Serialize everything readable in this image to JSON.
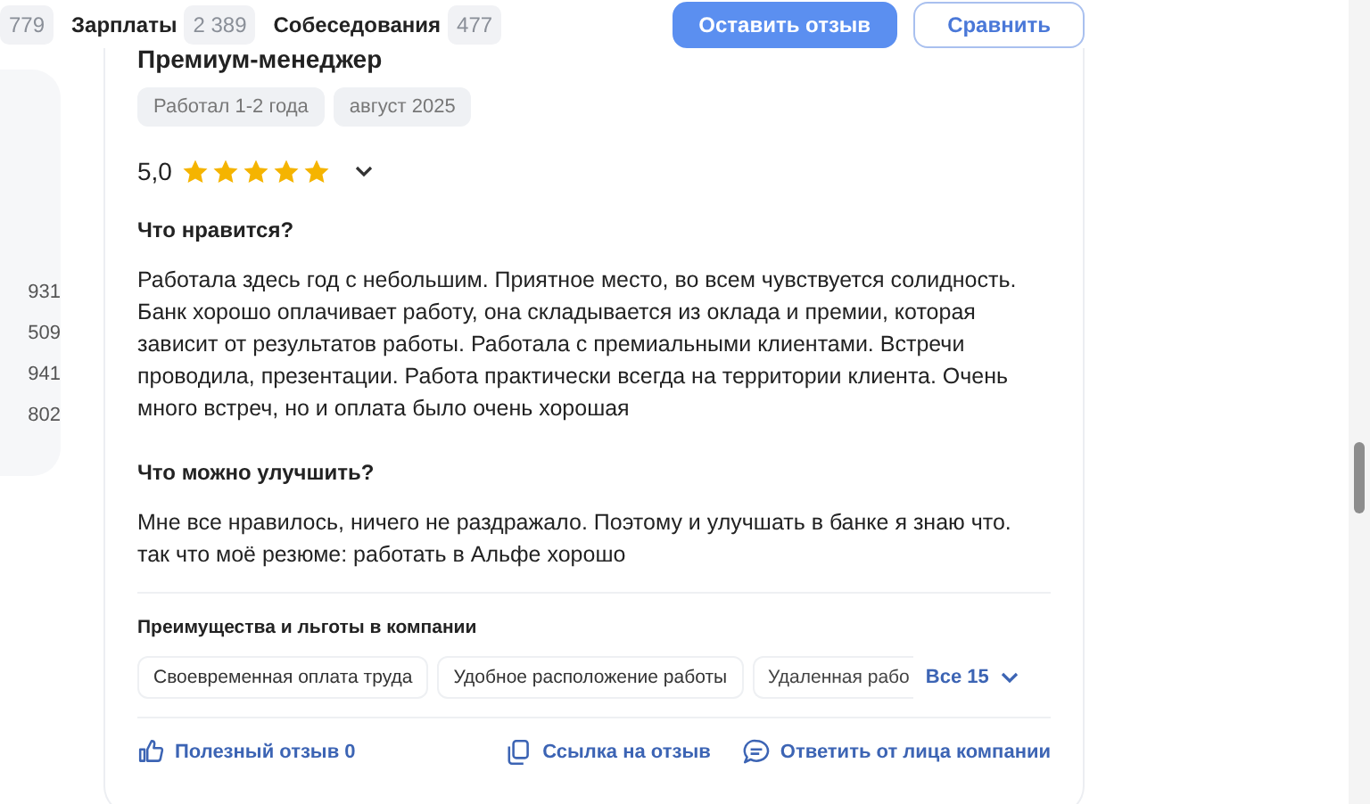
{
  "header": {
    "tabs": [
      {
        "count": "779"
      },
      {
        "label": "Зарплаты",
        "count": "2 389"
      },
      {
        "label": "Собеседования",
        "count": "477"
      }
    ],
    "buttons": [
      {
        "label": "Оставить отзыв",
        "kind": "primary"
      },
      {
        "label": "Сравнить",
        "kind": "outline"
      }
    ]
  },
  "sidebar": {
    "counts": [
      "931",
      "509",
      "941",
      "802"
    ]
  },
  "review": {
    "position": "Премиум-менеджер",
    "tags": [
      "Работал 1-2 года",
      "август 2025"
    ],
    "rating": "5,0",
    "stars": 5,
    "sections": [
      {
        "title": "Что нравится?",
        "text": "Работала здесь год с небольшим. Приятное место, во всем чувствуется солидность. Банк хорошо оплачивает работу, она складывается из оклада и премии, которая зависит от результатов работы. Работала с премиальными клиентами. Встречи проводила, презентации. Работа практически всегда на территории клиента. Очень много встреч, но и оплата было очень хорошая"
      },
      {
        "title": "Что можно улучшить?",
        "text": "Мне все нравилось, ничего не раздражало. Поэтому и улучшать в банке я знаю что. так что моё резюме: работать в Альфе хорошо"
      }
    ],
    "benefits_title": "Преимущества и льготы в компании",
    "benefits": [
      "Своевременная оплата труда",
      "Удобное расположение работы",
      "Удаленная рабо"
    ],
    "benefits_more": "Все 15",
    "actions": [
      {
        "label": "Полезный отзыв 0",
        "kind": "like"
      },
      {
        "label": "Ссылка на отзыв",
        "kind": "copy"
      },
      {
        "label": "Ответить от лица компании",
        "kind": "reply"
      }
    ]
  }
}
